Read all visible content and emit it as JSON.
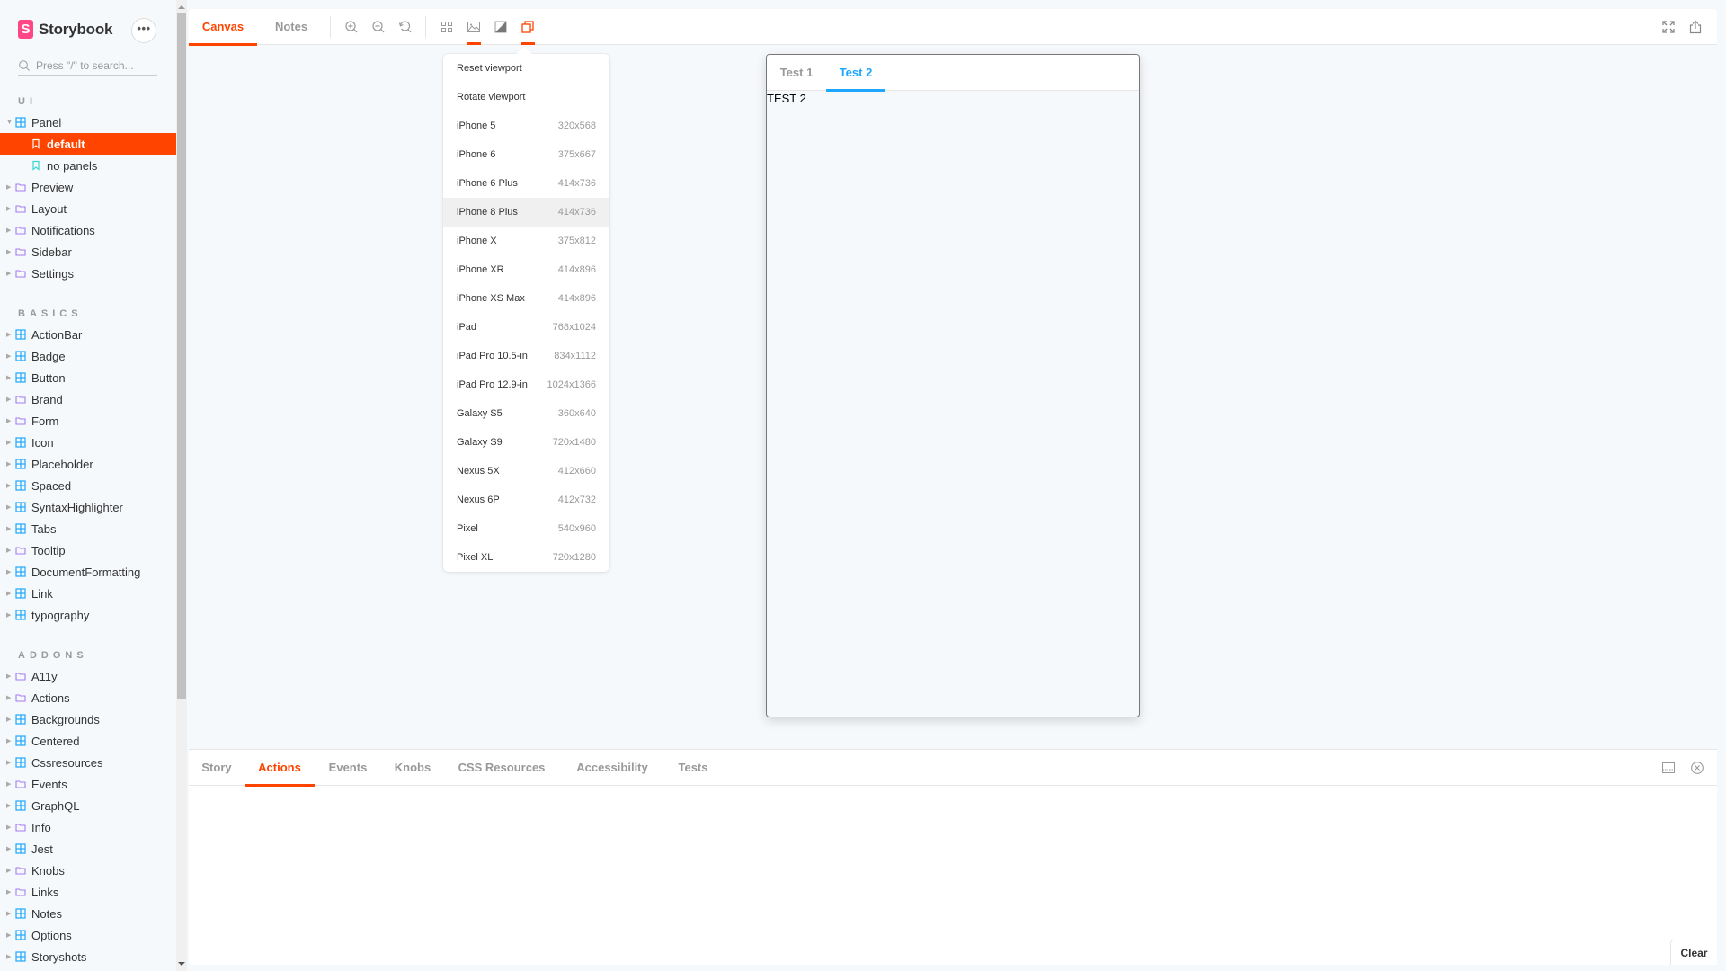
{
  "brand": {
    "name": "Storybook",
    "logo_letter": "S"
  },
  "sidebar": {
    "menu_button": "•••",
    "search": {
      "placeholder": "Press \"/\" to search...",
      "value": ""
    },
    "sections": [
      {
        "label": "UI",
        "items": [
          {
            "label": "Panel",
            "type": "component",
            "expanded": true,
            "children": [
              {
                "label": "default",
                "type": "story",
                "selected": true
              },
              {
                "label": "no panels",
                "type": "story",
                "selected": false
              }
            ]
          },
          {
            "label": "Preview",
            "type": "folder"
          },
          {
            "label": "Layout",
            "type": "folder"
          },
          {
            "label": "Notifications",
            "type": "folder"
          },
          {
            "label": "Sidebar",
            "type": "folder"
          },
          {
            "label": "Settings",
            "type": "folder"
          }
        ]
      },
      {
        "label": "BASICS",
        "items": [
          {
            "label": "ActionBar",
            "type": "component"
          },
          {
            "label": "Badge",
            "type": "component"
          },
          {
            "label": "Button",
            "type": "component"
          },
          {
            "label": "Brand",
            "type": "folder"
          },
          {
            "label": "Form",
            "type": "folder"
          },
          {
            "label": "Icon",
            "type": "component"
          },
          {
            "label": "Placeholder",
            "type": "component"
          },
          {
            "label": "Spaced",
            "type": "component"
          },
          {
            "label": "SyntaxHighlighter",
            "type": "component"
          },
          {
            "label": "Tabs",
            "type": "component"
          },
          {
            "label": "Tooltip",
            "type": "folder"
          },
          {
            "label": "DocumentFormatting",
            "type": "component"
          },
          {
            "label": "Link",
            "type": "component"
          },
          {
            "label": "typography",
            "type": "component"
          }
        ]
      },
      {
        "label": "ADDONS",
        "items": [
          {
            "label": "A11y",
            "type": "folder"
          },
          {
            "label": "Actions",
            "type": "folder"
          },
          {
            "label": "Backgrounds",
            "type": "component"
          },
          {
            "label": "Centered",
            "type": "component"
          },
          {
            "label": "Cssresources",
            "type": "component"
          },
          {
            "label": "Events",
            "type": "folder"
          },
          {
            "label": "GraphQL",
            "type": "component"
          },
          {
            "label": "Info",
            "type": "folder"
          },
          {
            "label": "Jest",
            "type": "component"
          },
          {
            "label": "Knobs",
            "type": "folder"
          },
          {
            "label": "Links",
            "type": "folder"
          },
          {
            "label": "Notes",
            "type": "component"
          },
          {
            "label": "Options",
            "type": "component"
          },
          {
            "label": "Storyshots",
            "type": "component"
          }
        ]
      }
    ]
  },
  "toolbar": {
    "tabs": [
      {
        "label": "Canvas",
        "active": true
      },
      {
        "label": "Notes",
        "active": false
      }
    ],
    "icons": [
      "zoom-in-icon",
      "zoom-out-icon",
      "zoom-reset-icon",
      "grid-icon",
      "background-image-icon",
      "contrast-icon",
      "viewport-icon",
      "fullscreen-icon",
      "share-icon"
    ]
  },
  "viewport_menu": {
    "actions": [
      "Reset viewport",
      "Rotate viewport"
    ],
    "devices": [
      {
        "name": "iPhone 5",
        "size": "320x568"
      },
      {
        "name": "iPhone 6",
        "size": "375x667"
      },
      {
        "name": "iPhone 6 Plus",
        "size": "414x736"
      },
      {
        "name": "iPhone 8 Plus",
        "size": "414x736",
        "hovered": true
      },
      {
        "name": "iPhone X",
        "size": "375x812"
      },
      {
        "name": "iPhone XR",
        "size": "414x896"
      },
      {
        "name": "iPhone XS Max",
        "size": "414x896"
      },
      {
        "name": "iPad",
        "size": "768x1024"
      },
      {
        "name": "iPad Pro 10.5-in",
        "size": "834x1112"
      },
      {
        "name": "iPad Pro 12.9-in",
        "size": "1024x1366"
      },
      {
        "name": "Galaxy S5",
        "size": "360x640"
      },
      {
        "name": "Galaxy S9",
        "size": "720x1480"
      },
      {
        "name": "Nexus 5X",
        "size": "412x660"
      },
      {
        "name": "Nexus 6P",
        "size": "412x732"
      },
      {
        "name": "Pixel",
        "size": "540x960"
      },
      {
        "name": "Pixel XL",
        "size": "720x1280"
      }
    ]
  },
  "preview": {
    "tabs": [
      {
        "label": "Test 1",
        "active": false
      },
      {
        "label": "Test 2",
        "active": true
      }
    ],
    "content": "TEST 2"
  },
  "addons_panel": {
    "tabs": [
      {
        "label": "Story",
        "active": false
      },
      {
        "label": "Actions",
        "active": true
      },
      {
        "label": "Events",
        "active": false
      },
      {
        "label": "Knobs",
        "active": false
      },
      {
        "label": "CSS Resources",
        "active": false
      },
      {
        "label": "Accessibility",
        "active": false
      },
      {
        "label": "Tests",
        "active": false
      }
    ],
    "clear_label": "Clear"
  },
  "colors": {
    "accent": "#ff4400",
    "secondary": "#1ea7fd",
    "brand": "#ff4785",
    "component_icon": "#1ea7fd",
    "folder_icon": "#a57cf0",
    "story_icon": "#37d5d3"
  }
}
